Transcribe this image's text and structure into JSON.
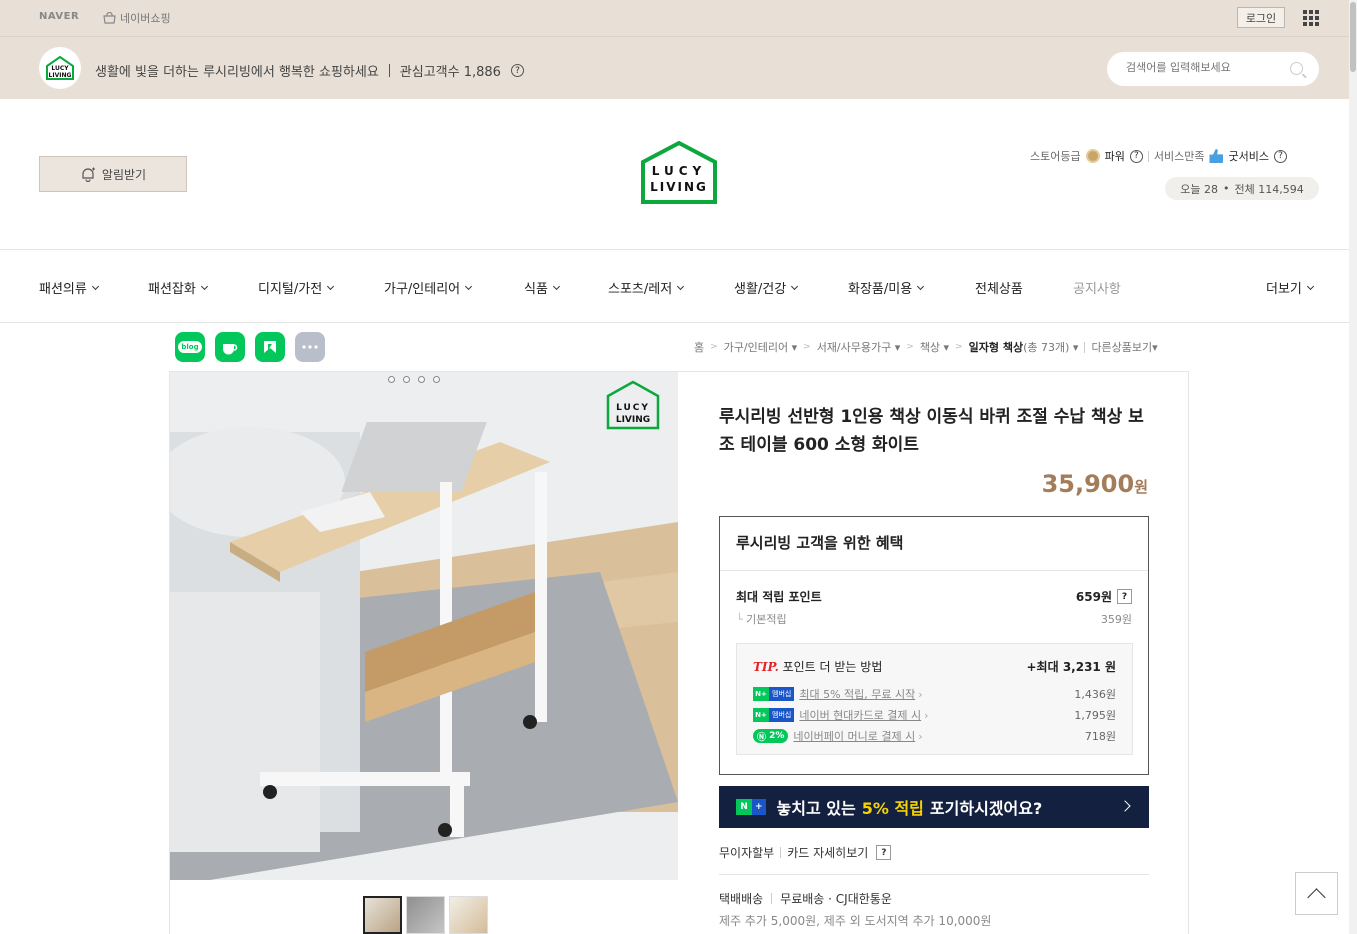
{
  "topbar": {
    "naver": "NAVER",
    "shopping": "네이버쇼핑",
    "login": "로그인"
  },
  "banner": {
    "tagline": "생활에 빛을 더하는 루시리빙에서 행복한 쇼핑하세요",
    "interest": "관심고객수 1,886",
    "search_placeholder": "검색어를 입력해보세요"
  },
  "header": {
    "alarm": "알림받기",
    "logo_line1": "LUCY",
    "logo_line2": "LIVING",
    "grade_label": "스토어등급",
    "grade_value": "파워",
    "service_label": "서비스만족",
    "service_value": "굿서비스",
    "today": "오늘 28",
    "total": "전체 114,594"
  },
  "nav": {
    "items": [
      "패션의류",
      "패션잡화",
      "디지털/가전",
      "가구/인테리어",
      "식품",
      "스포츠/레저",
      "생활/건강",
      "화장품/미용",
      "전체상품",
      "공지사항",
      "더보기"
    ]
  },
  "breadcrumb": {
    "items": [
      "홈",
      "가구/인테리어",
      "서재/사무용가구",
      "책상"
    ],
    "current": "일자형 책상",
    "count": "(총 73개)",
    "other": "다른상품보기"
  },
  "share": {
    "blog": "blog"
  },
  "product": {
    "title": "루시리빙 선반형 1인용 책상 이동식 바퀴 조절 수납 책상 보조 테이블 600 소형 화이트",
    "price": "35,900",
    "currency": "원"
  },
  "benefit": {
    "heading": "루시리빙 고객을 위한 혜택",
    "max_point_label": "최대 적립 포인트",
    "max_point_value": "659원",
    "base_label": "기본적립",
    "base_value": "359원",
    "tip_label": "TIP.",
    "tip_text": "포인트 더 받는 방법",
    "tip_max": "+최대 3,231 원",
    "tips": [
      {
        "badge": "멤버십",
        "text": "최대 5% 적립, 무료 시작",
        "value": "1,436원"
      },
      {
        "badge": "멤버십",
        "text": "네이버 현대카드로 결제 시",
        "value": "1,795원"
      },
      {
        "badge": "2%",
        "text": "네이버페이 머니로 결제 시",
        "value": "718원"
      }
    ]
  },
  "promo": {
    "prefix": "놓치고 있는",
    "highlight": "5% 적립",
    "suffix": "포기하시겠어요?"
  },
  "installment": {
    "label": "무이자할부",
    "card": "카드 자세히보기"
  },
  "shipping": {
    "label": "택배배송",
    "value": "무료배송 · CJ대한통운",
    "extra": "제주 추가 5,000원, 제주 외 도서지역 추가 10,000원"
  },
  "colors": {
    "price": "#a57c5a",
    "brand_green": "#0ca83e",
    "promo_bg": "#14203f",
    "promo_highlight": "#f6d400"
  }
}
